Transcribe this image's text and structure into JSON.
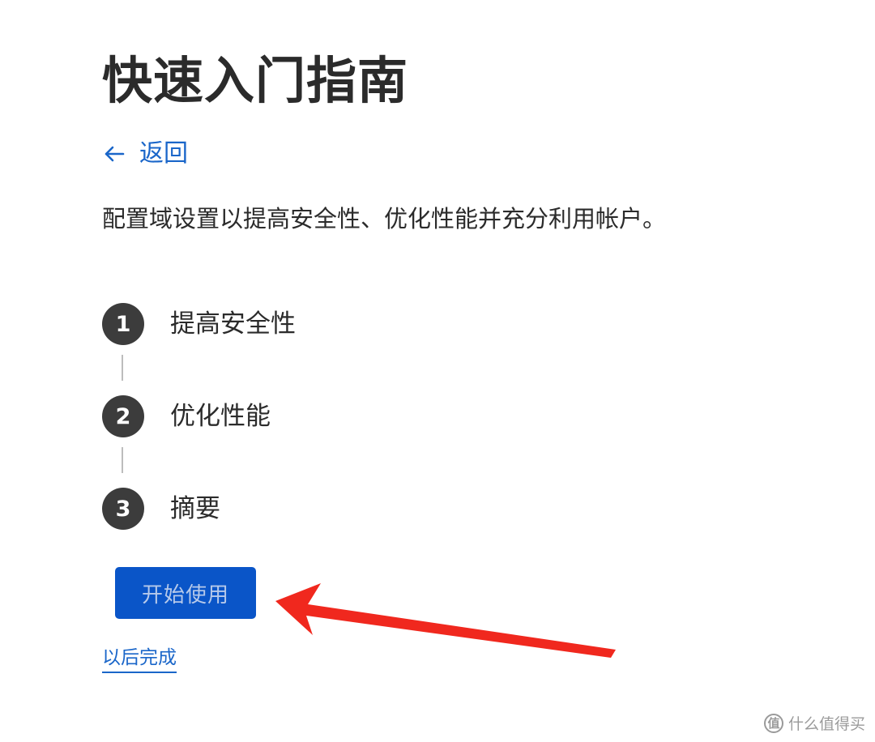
{
  "page": {
    "title": "快速入门指南",
    "back_label": "返回",
    "description": "配置域设置以提高安全性、优化性能并充分利用帐户。"
  },
  "steps": [
    {
      "number": "1",
      "label": "提高安全性"
    },
    {
      "number": "2",
      "label": "优化性能"
    },
    {
      "number": "3",
      "label": "摘要"
    }
  ],
  "actions": {
    "start_label": "开始使用",
    "later_label": "以后完成"
  },
  "annotation": {
    "arrow_color": "#f0281e"
  },
  "watermark": {
    "logo_glyph": "值",
    "text": "什么值得买"
  },
  "colors": {
    "link": "#1a66c9",
    "primary_button": "#0a55c8",
    "step_circle": "#3c3c3c"
  }
}
